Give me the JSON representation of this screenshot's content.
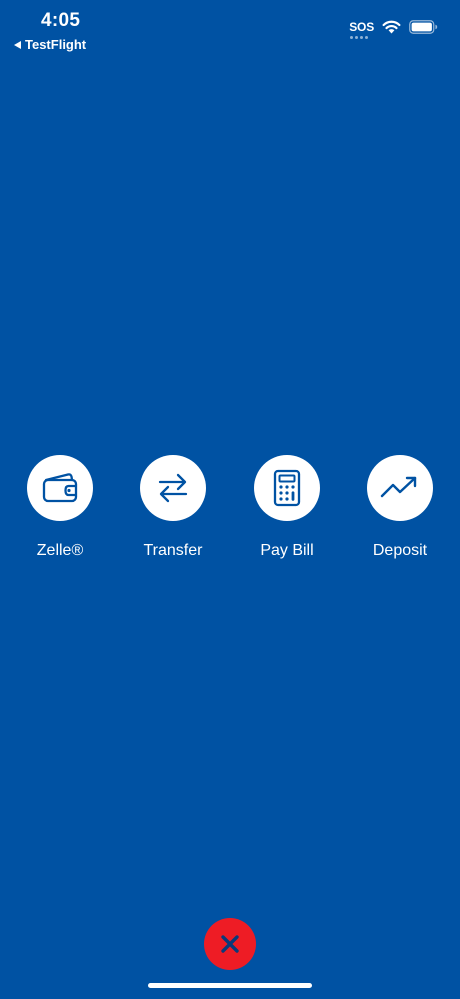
{
  "status_bar": {
    "time": "4:05",
    "back_app": "TestFlight",
    "sos": "SOS",
    "wifi_icon": "wifi-icon",
    "battery_icon": "battery-icon"
  },
  "actions": [
    {
      "label": "Zelle®",
      "icon": "wallet-icon"
    },
    {
      "label": "Transfer",
      "icon": "transfer-arrows-icon"
    },
    {
      "label": "Pay Bill",
      "icon": "calculator-icon"
    },
    {
      "label": "Deposit",
      "icon": "trend-up-icon"
    }
  ],
  "close": {
    "icon": "close-icon"
  },
  "colors": {
    "background": "#0052a3",
    "icon_blue": "#0052a3",
    "close_red": "#ee1c25",
    "white": "#ffffff"
  }
}
